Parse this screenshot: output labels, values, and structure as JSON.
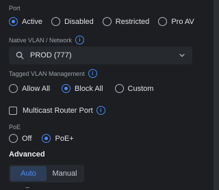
{
  "port": {
    "label": "Port",
    "options": [
      "Active",
      "Disabled",
      "Restricted",
      "Pro AV"
    ],
    "selected": "Active"
  },
  "native_vlan": {
    "label": "Native VLAN / Network",
    "value": "PROD (777)"
  },
  "tagged_vlan": {
    "label": "Tagged VLAN Management",
    "options": [
      "Allow All",
      "Block All",
      "Custom"
    ],
    "selected": "Block All"
  },
  "multicast": {
    "label": "Multicast Router Port",
    "checked": false
  },
  "poe": {
    "label": "PoE",
    "options": [
      "Off",
      "PoE+"
    ],
    "selected": "PoE+"
  },
  "advanced": {
    "title": "Advanced",
    "options": [
      "Auto",
      "Manual"
    ],
    "selected": "Auto"
  },
  "colors": {
    "accent": "#4a8cf7",
    "background": "#1c1e22",
    "field": "#26292e"
  }
}
